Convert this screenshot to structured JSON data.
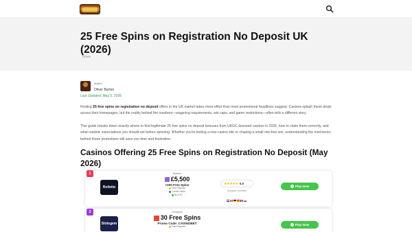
{
  "header": {
    "logo_name": "casino-site-logo",
    "search_icon": "search-icon"
  },
  "hero": {
    "title": "25 Free Spins on Registration No Deposit UK (2026)",
    "breadcrumb": "Home"
  },
  "author": {
    "role": "Author",
    "name": "Oliver Burton",
    "last_updated": "Last Updated: May 5, 2026"
  },
  "intro": {
    "p1_bold": "25 free spins on registration no deposit",
    "p1_before": "Finding ",
    "p1_after": " offers in the UK market takes more effort than most promotional headlines suggest. Casinos splash these deals across their homepages, but the reality behind the numbers—wagering requirements, win caps, and game restrictions—often tells a different story.",
    "p2": "This guide breaks down exactly where to find legitimate 25 free spins no deposit bonuses from UKGC-licensed casinos in 2026, how to claim them correctly, and what realistic expectations you should set before spinning. Whether you're testing a new casino site or chasing a small risk-free win, understanding the mechanics behind these promotions will save you time and frustration."
  },
  "section": {
    "title": "Casinos Offering 25 Free Spins on Registration No Deposit (May 2026)"
  },
  "casinos": [
    {
      "rank": "1",
      "logo_text": "Rolletto",
      "brand": "Rolletto",
      "offer": "£5,500",
      "sub": "+200 Free Spins",
      "features": [
        "Fast Payouts",
        "Credit Cards",
        "No KYC"
      ],
      "rating_stars": "★★★★★",
      "rating": "5.0",
      "accepted_label": "Accepted Countries",
      "cta": "Play Now"
    },
    {
      "rank": "2",
      "logo_text": "Slotsgem",
      "brand": "Slotsgem",
      "offer": "30 Free Spins",
      "sub": "Promo Code: CASINOBET",
      "features": [
        "Fast Payouts"
      ],
      "cta": "Play Now"
    }
  ],
  "colors": {
    "accent_green": "#45c54b",
    "rank1": "#e53b5a",
    "rank2": "#9b3fd4",
    "updated_green": "#2f9a4b"
  }
}
